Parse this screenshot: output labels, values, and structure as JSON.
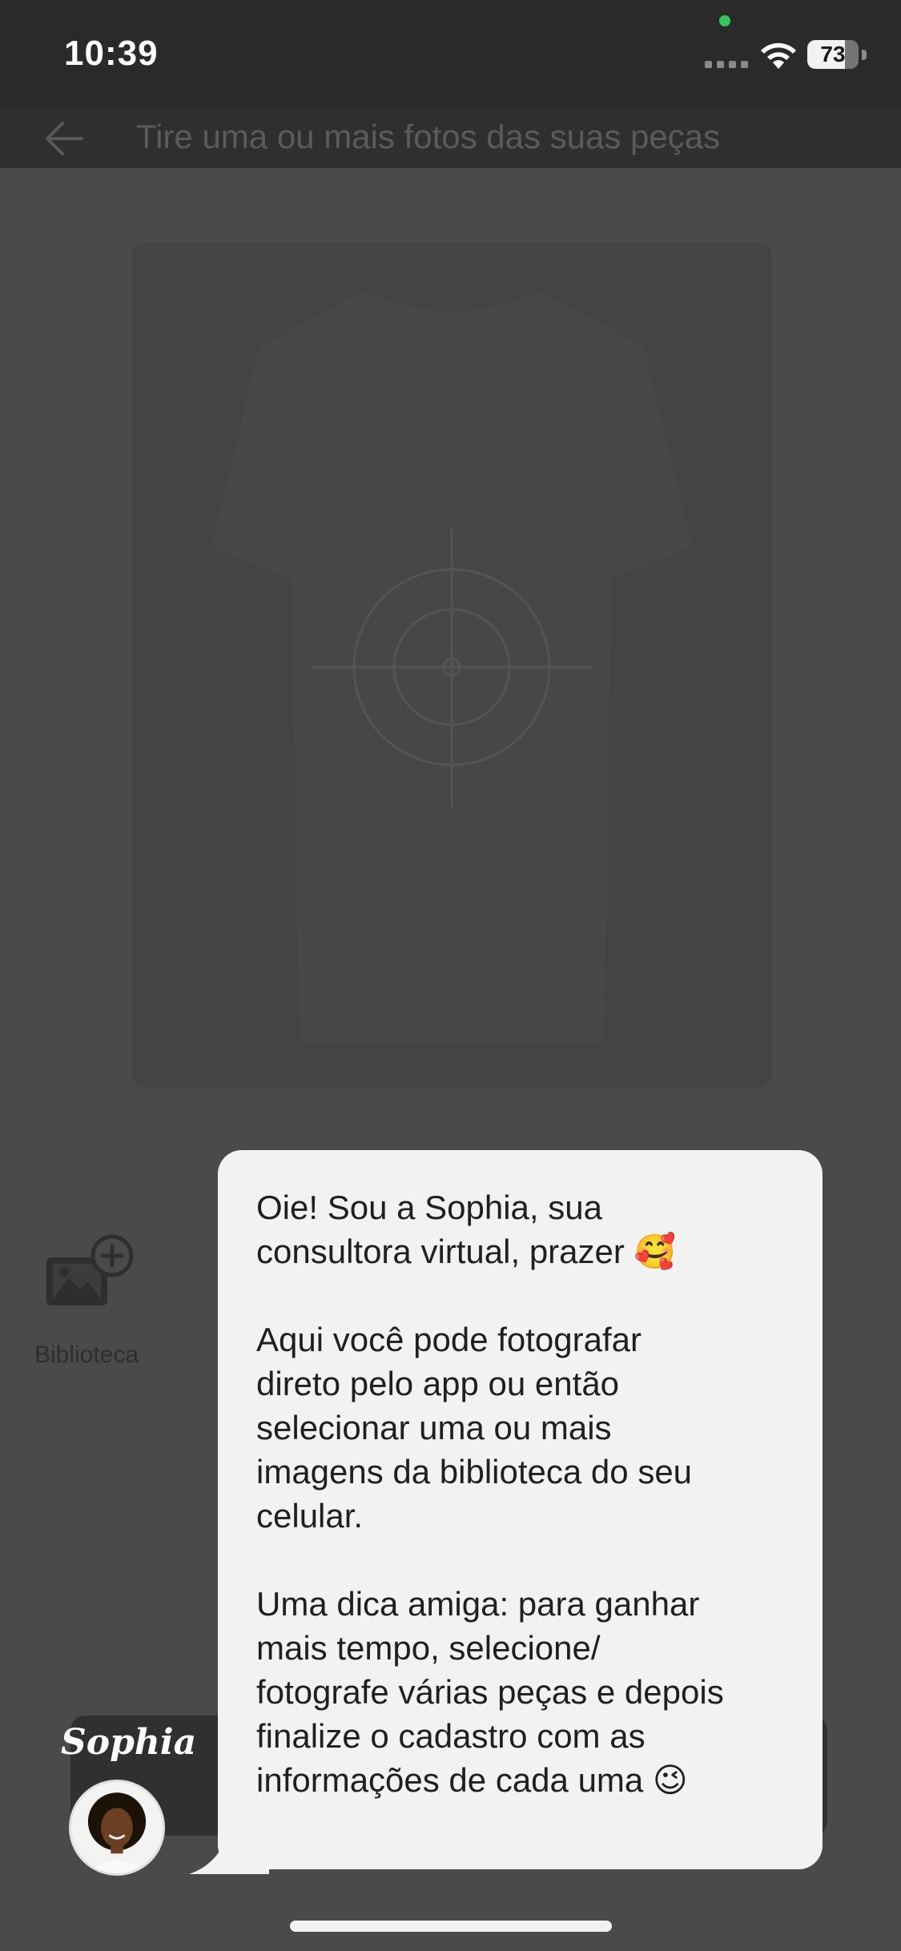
{
  "status_bar": {
    "time": "10:39",
    "battery": "73",
    "battery_level_percent": 73
  },
  "header": {
    "title": "Tire uma ou mais fotos das suas peças"
  },
  "library": {
    "label": "Biblioteca"
  },
  "assistant": {
    "name": "Sophia",
    "message": "Oie! Sou a Sophia, sua\nconsultora virtual, prazer 🥰\n\nAqui você pode fotografar\ndireto pelo app ou então\nselecionar uma ou mais\nimagens da biblioteca do seu\ncelular.\n\nUma dica amiga: para ganhar\nmais tempo, selecione/\nfotografe várias peças e depois\nfinalize o cadastro com as\ninformações de cada uma 😉"
  },
  "colors": {
    "overlay_background": "#4a4a4a",
    "bubble_background": "#f2f2f2",
    "camera_indicator": "#34c759"
  }
}
